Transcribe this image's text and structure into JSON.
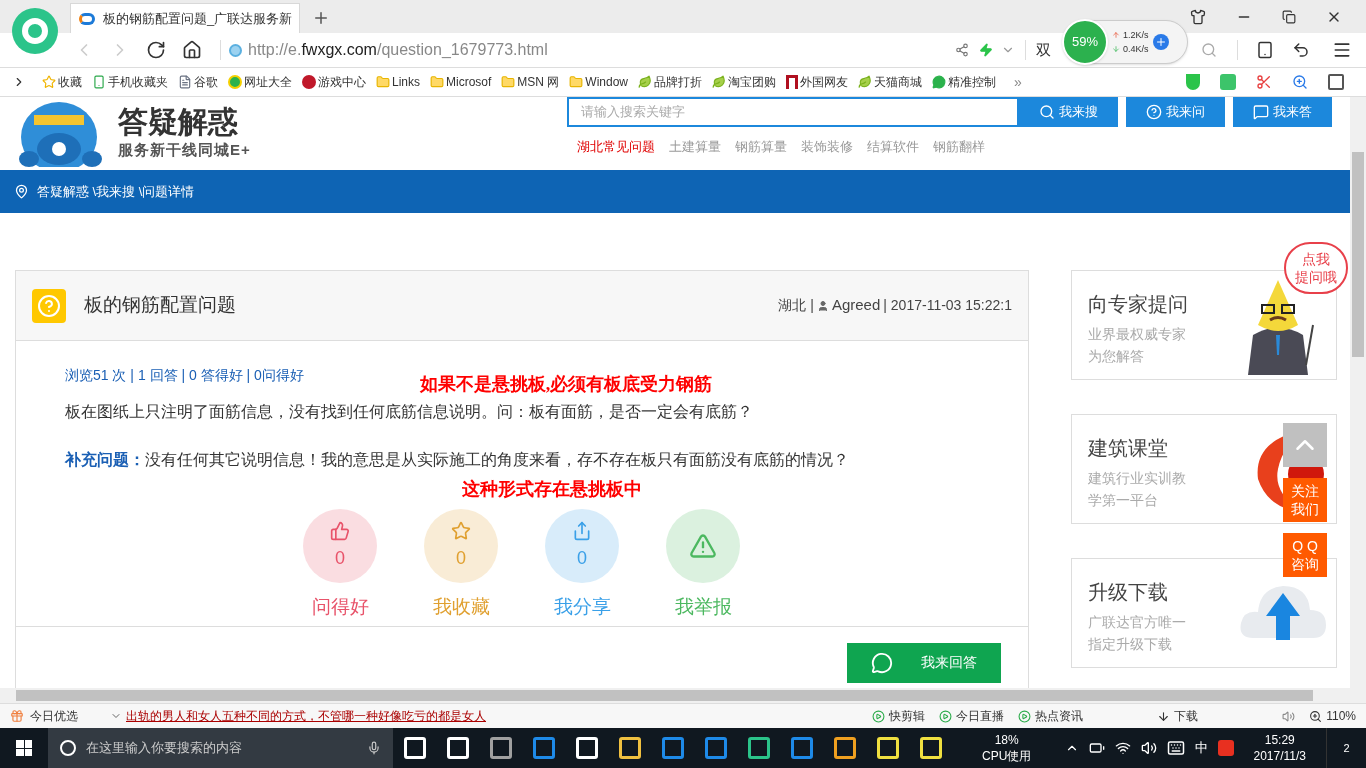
{
  "browser": {
    "tab_title": "板的钢筋配置问题_广联达服务新",
    "url_prefix": "http://e.",
    "url_domain": "fwxgx.com",
    "url_path": "/question_1679773.html",
    "address_side_text": "双",
    "bookmarks": [
      {
        "label": "收藏",
        "kind": "star"
      },
      {
        "label": "手机收藏夹",
        "kind": "phone"
      },
      {
        "label": "谷歌",
        "kind": "page"
      },
      {
        "label": "网址大全",
        "kind": "globe"
      },
      {
        "label": "游戏中心",
        "kind": "game"
      },
      {
        "label": "Links",
        "kind": "folder"
      },
      {
        "label": "Microsof",
        "kind": "folder"
      },
      {
        "label": "MSN 网",
        "kind": "folder"
      },
      {
        "label": "Window",
        "kind": "folder"
      },
      {
        "label": "品牌打折",
        "kind": "leaf"
      },
      {
        "label": "淘宝团购",
        "kind": "leaf"
      },
      {
        "label": "外国网友",
        "kind": "flag"
      },
      {
        "label": "天猫商城",
        "kind": "leaf"
      },
      {
        "label": "精准控制",
        "kind": "chat"
      }
    ],
    "more": "»"
  },
  "speed_widget": {
    "percent": "59%",
    "up": "1.2K/s",
    "down": "0.4K/s"
  },
  "header": {
    "logo_title": "答疑解惑",
    "logo_subtitle": "服务新干线同城E+",
    "search_placeholder": "请输入搜索关键字",
    "buttons": [
      {
        "label": "我来搜",
        "kind": "search"
      },
      {
        "label": "我来问",
        "kind": "ask"
      },
      {
        "label": "我来答",
        "kind": "answer"
      }
    ],
    "nav": [
      {
        "label": "湖北常见问题",
        "selected": true
      },
      {
        "label": "土建算量",
        "selected": false
      },
      {
        "label": "钢筋算量",
        "selected": false
      },
      {
        "label": "装饰装修",
        "selected": false
      },
      {
        "label": "结算软件",
        "selected": false
      },
      {
        "label": "钢筋翻样",
        "selected": false
      }
    ]
  },
  "breadcrumb": "答疑解惑 \\我来搜 \\问题详情",
  "question": {
    "title": "板的钢筋配置问题",
    "region": "湖北 |",
    "user": "Agreed",
    "time": "| 2017-11-03 15:22:1",
    "stats": "浏览51 次 | 1 回答 | 0 答得好 | 0问得好",
    "annotation_1": "如果不是悬挑板,必须有板底受力钢筋",
    "body": "板在图纸上只注明了面筋信息，没有找到任何底筋信息说明。问：板有面筋，是否一定会有底筋？",
    "supplement_label": "补充问题：",
    "supplement": "没有任何其它说明信息！我的意思是从实际施工的角度来看，存不存在板只有面筋没有底筋的情况？",
    "annotation_2": "这种形式存在悬挑板中",
    "actions": [
      {
        "kind": "like",
        "count": "0",
        "label": "问得好",
        "color": "#e8536a"
      },
      {
        "kind": "star",
        "count": "0",
        "label": "我收藏",
        "color": "#e0a030"
      },
      {
        "kind": "share",
        "count": "0",
        "label": "我分享",
        "color": "#3aa0e8"
      },
      {
        "kind": "report",
        "label": "我举报",
        "color": "#4cb860"
      }
    ],
    "answer_button": "我来回答"
  },
  "sidebar": [
    {
      "kind": "expert",
      "title": "向专家提问",
      "lines": [
        "业界最权威专家",
        "为您解答"
      ]
    },
    {
      "kind": "course",
      "title": "建筑课堂",
      "lines": [
        "建筑行业实训教",
        "学第一平台"
      ]
    },
    {
      "kind": "download",
      "title": "升级下载",
      "lines": [
        "广联达官方唯一",
        "指定升级下载"
      ]
    }
  ],
  "bubble": [
    "点我",
    "提问哦"
  ],
  "floating": {
    "follow": [
      "关注",
      "我们"
    ],
    "qq": [
      "Q Q",
      "咨询"
    ]
  },
  "status_bar": {
    "pick": "今日优选",
    "news": "出轨的男人和女人五种不同的方式，不管哪一种好像吃亏的都是女人",
    "items": [
      "快剪辑",
      "今日直播",
      "热点资讯"
    ],
    "download": "下载",
    "zoom": "110%"
  },
  "taskbar": {
    "search_placeholder": "在这里输入你要搜索的内容",
    "cpu_value": "18%",
    "cpu_label": "CPU使用",
    "ime": "中",
    "time": "15:29",
    "date": "2017/11/3",
    "notifications": "2"
  }
}
